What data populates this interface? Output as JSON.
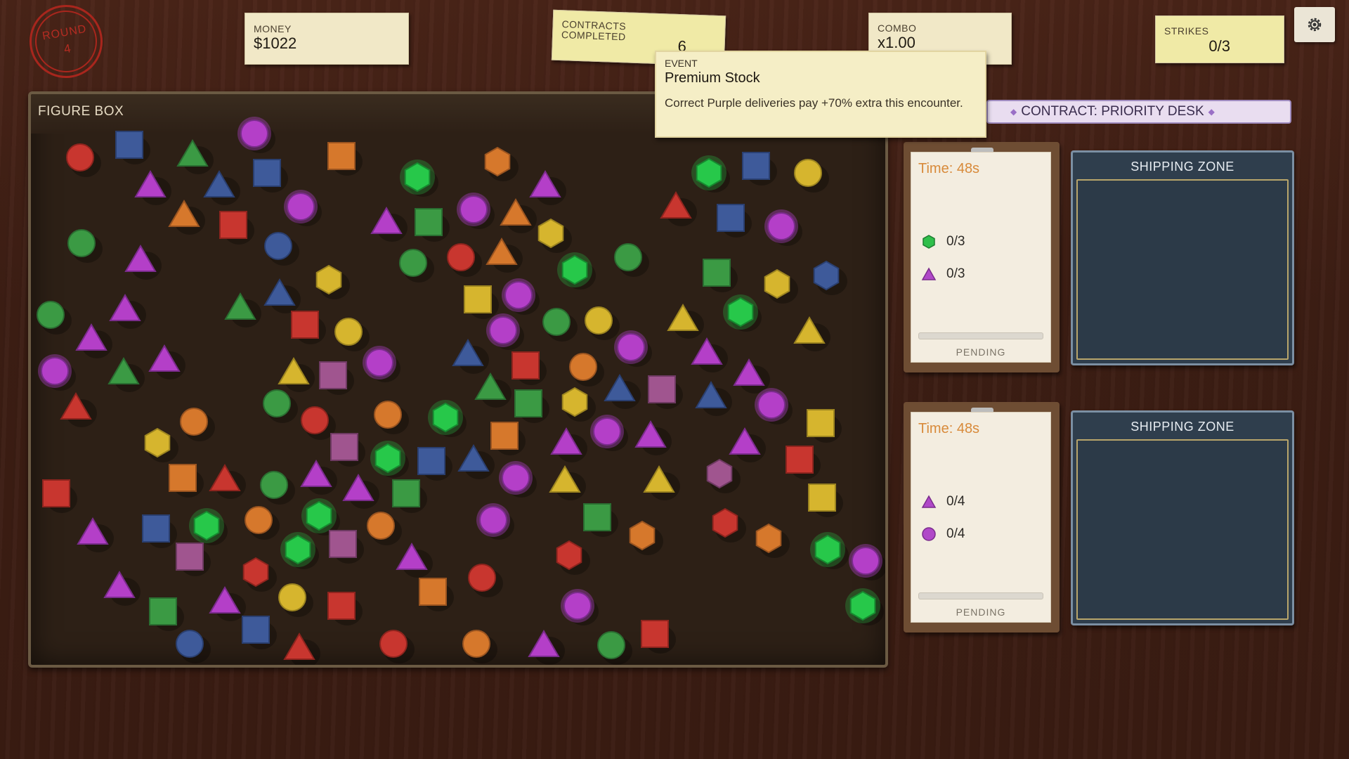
{
  "hud": {
    "round_label": "ROUND",
    "round_value": "4",
    "money_label": "MONEY",
    "money_value": "$1022",
    "contracts_label_line1": "CONTRACTS",
    "contracts_label_line2": "COMPLETED",
    "contracts_value": "6",
    "combo_label": "COMBO",
    "combo_value": "x1.00",
    "strikes_label": "STRIKES",
    "strikes_value": "0/3",
    "settings_icon": "gear-icon"
  },
  "event": {
    "label": "EVENT",
    "title": "Premium Stock",
    "description": "Correct Purple deliveries pay +70% extra this encounter."
  },
  "figure_box": {
    "title": "FIGURE BOX"
  },
  "contract_banner": {
    "text": "CONTRACT: PRIORITY DESK"
  },
  "contracts": [
    {
      "time": "Time: 48s",
      "requirements": [
        {
          "shape": "hexagon",
          "color": "#2fbf4a",
          "count": "0/3"
        },
        {
          "shape": "triangle",
          "color": "#b048c8",
          "count": "0/3"
        }
      ],
      "progress": 0,
      "status": "PENDING"
    },
    {
      "time": "Time: 48s",
      "requirements": [
        {
          "shape": "triangle",
          "color": "#b048c8",
          "count": "0/4"
        },
        {
          "shape": "circle",
          "color": "#b048c8",
          "count": "0/4"
        }
      ],
      "progress": 0,
      "status": "PENDING"
    }
  ],
  "shipping_zones": [
    {
      "title": "SHIPPING ZONE"
    },
    {
      "title": "SHIPPING ZONE"
    }
  ],
  "colors": {
    "red": "#c8362f",
    "blue": "#3e5a9a",
    "green": "#3b9a44",
    "bright_green": "#27c84a",
    "orange": "#d6782c",
    "yellow": "#d6b52e",
    "purple": "#b43fc8",
    "pink": "#a0558f"
  }
}
